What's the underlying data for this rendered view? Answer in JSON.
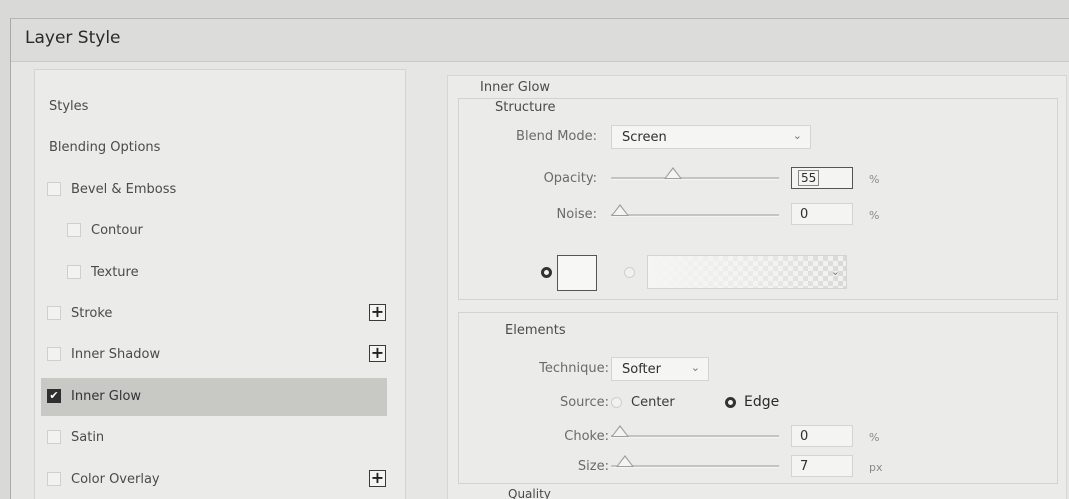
{
  "window": {
    "title": "Layer Style"
  },
  "styles_list": {
    "items": [
      {
        "label": "Styles",
        "checkbox": false,
        "checked": false,
        "indent": 0,
        "add": false,
        "selected": false
      },
      {
        "label": "Blending Options",
        "checkbox": false,
        "checked": false,
        "indent": 0,
        "add": false,
        "selected": false
      },
      {
        "label": "Bevel & Emboss",
        "checkbox": true,
        "checked": false,
        "indent": 0,
        "add": false,
        "selected": false
      },
      {
        "label": "Contour",
        "checkbox": true,
        "checked": false,
        "indent": 1,
        "add": false,
        "selected": false
      },
      {
        "label": "Texture",
        "checkbox": true,
        "checked": false,
        "indent": 1,
        "add": false,
        "selected": false
      },
      {
        "label": "Stroke",
        "checkbox": true,
        "checked": false,
        "indent": 0,
        "add": true,
        "selected": false
      },
      {
        "label": "Inner Shadow",
        "checkbox": true,
        "checked": false,
        "indent": 0,
        "add": true,
        "selected": false
      },
      {
        "label": "Inner Glow",
        "checkbox": true,
        "checked": true,
        "indent": 0,
        "add": false,
        "selected": true
      },
      {
        "label": "Satin",
        "checkbox": true,
        "checked": false,
        "indent": 0,
        "add": false,
        "selected": false
      },
      {
        "label": "Color Overlay",
        "checkbox": true,
        "checked": false,
        "indent": 0,
        "add": true,
        "selected": false
      }
    ],
    "add_symbol": "+",
    "check_symbol": "✔"
  },
  "inner_glow": {
    "heading": "Inner Glow",
    "structure": {
      "heading": "Structure",
      "blend_mode_label": "Blend Mode:",
      "blend_mode_value": "Screen",
      "opacity_label": "Opacity:",
      "opacity_value": "55",
      "opacity_unit": "%",
      "opacity_level": 0.35,
      "noise_label": "Noise:",
      "noise_value": "0",
      "noise_unit": "%",
      "noise_level": 0.0,
      "color_mode": "solid",
      "glow_color": "#f7f7f5"
    },
    "elements": {
      "heading": "Elements",
      "technique_label": "Technique:",
      "technique_value": "Softer",
      "source_label": "Source:",
      "source_center": "Center",
      "source_edge": "Edge",
      "source_selected": "Edge",
      "choke_label": "Choke:",
      "choke_value": "0",
      "choke_unit": "%",
      "choke_level": 0.0,
      "size_label": "Size:",
      "size_value": "7",
      "size_unit": "px",
      "size_level": 0.03
    },
    "quality": {
      "heading": "Quality"
    }
  },
  "icons": {
    "dropdown": "chevron-down-icon",
    "add": "plus-icon",
    "check": "checkmark-icon"
  }
}
